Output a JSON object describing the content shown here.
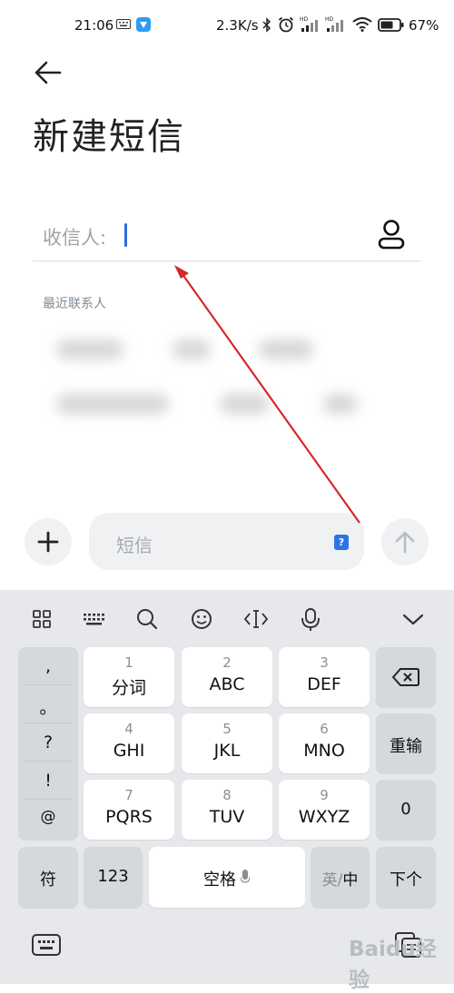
{
  "status_bar": {
    "time": "21:06",
    "net_speed": "2.3K/s",
    "battery_pct": "67%"
  },
  "header": {
    "title": "新建短信"
  },
  "recipient": {
    "label": "收信人:"
  },
  "recent": {
    "label": "最近联系人"
  },
  "compose": {
    "placeholder": "短信",
    "sim_badge": "?"
  },
  "keyboard": {
    "punctuation": [
      ",",
      "。",
      "?",
      "!",
      "@"
    ],
    "keys": [
      {
        "num": "1",
        "label": "分词"
      },
      {
        "num": "2",
        "label": "ABC"
      },
      {
        "num": "3",
        "label": "DEF"
      },
      {
        "num": "4",
        "label": "GHI"
      },
      {
        "num": "5",
        "label": "JKL"
      },
      {
        "num": "6",
        "label": "MNO"
      },
      {
        "num": "7",
        "label": "PQRS"
      },
      {
        "num": "8",
        "label": "TUV"
      },
      {
        "num": "9",
        "label": "WXYZ"
      }
    ],
    "reinput": "重输",
    "zero": "0",
    "symbol": "符",
    "numeric": "123",
    "space": "空格",
    "lang_en": "英",
    "lang_sep": "/",
    "lang_zh": "中",
    "next": "下个"
  },
  "watermark": "Baidu经验",
  "colors": {
    "accent": "#2a6fe0",
    "annotation_arrow": "#d42a2a",
    "keyboard_bg": "#e6e8ec"
  }
}
